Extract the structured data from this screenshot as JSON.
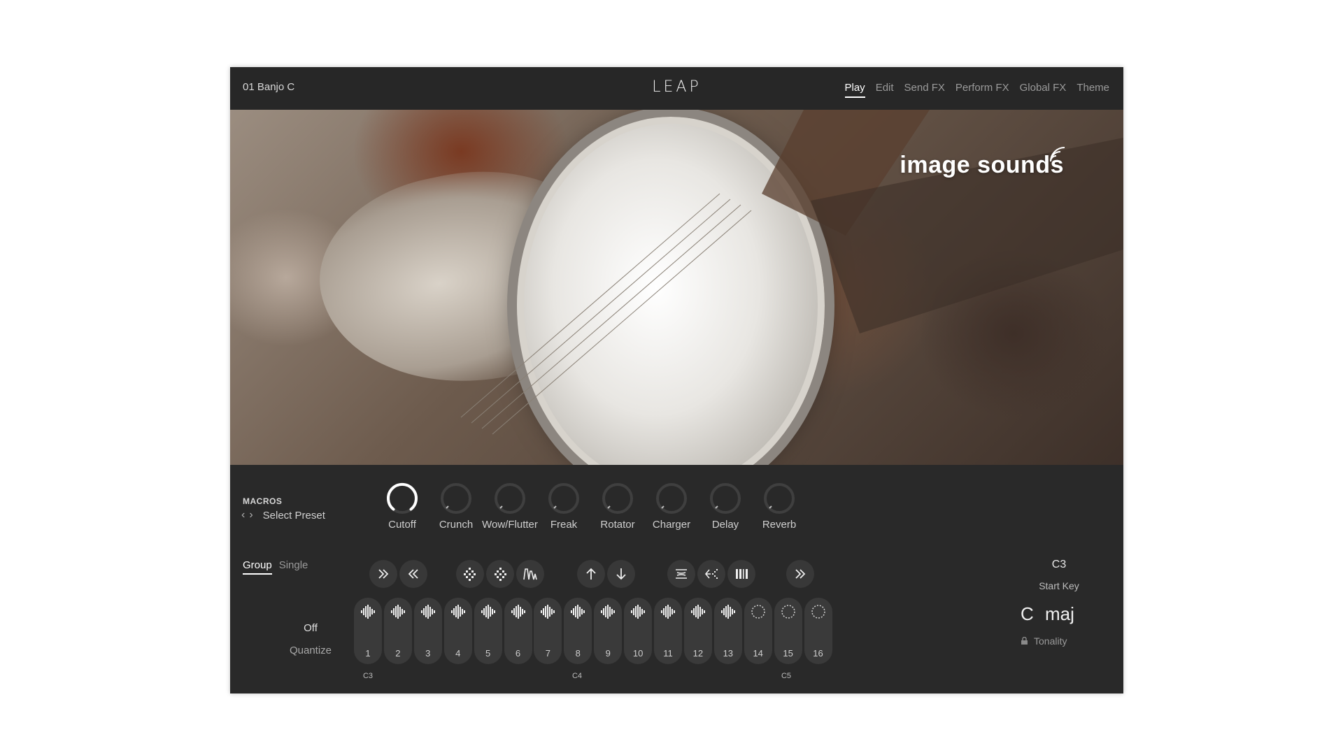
{
  "header": {
    "preset_name": "01 Banjo C",
    "logo": "LEAP",
    "nav": [
      {
        "label": "Play",
        "active": true
      },
      {
        "label": "Edit",
        "active": false
      },
      {
        "label": "Send FX",
        "active": false
      },
      {
        "label": "Perform FX",
        "active": false
      },
      {
        "label": "Global FX",
        "active": false
      },
      {
        "label": "Theme",
        "active": false
      }
    ]
  },
  "hero": {
    "brand": "image sounds"
  },
  "macros": {
    "title": "MACROS",
    "select_preset": "Select Preset",
    "knobs": [
      {
        "label": "Cutoff",
        "value": 0.92
      },
      {
        "label": "Crunch",
        "value": 0.0
      },
      {
        "label": "Wow/Flutter",
        "value": 0.0
      },
      {
        "label": "Freak",
        "value": 0.0
      },
      {
        "label": "Rotator",
        "value": 0.0
      },
      {
        "label": "Charger",
        "value": 0.0
      },
      {
        "label": "Delay",
        "value": 0.0
      },
      {
        "label": "Reverb",
        "value": 0.0
      }
    ]
  },
  "mode": {
    "group": "Group",
    "single": "Single",
    "active": "Group"
  },
  "quantize": {
    "value": "Off",
    "label": "Quantize"
  },
  "toolbar_icons": [
    "double-chevron-right-icon",
    "double-chevron-left-icon",
    "shuffle-pattern-icon",
    "random-pattern-icon",
    "envelope-shape-icon",
    "arrow-up-icon",
    "arrow-down-icon",
    "swap-icon",
    "reverse-icon",
    "slices-icon",
    "double-chevron-right-icon"
  ],
  "pads": {
    "labels": [
      "1",
      "2",
      "3",
      "4",
      "5",
      "6",
      "7",
      "8",
      "9",
      "10",
      "11",
      "12",
      "13",
      "14",
      "15",
      "16"
    ],
    "loaded": [
      true,
      true,
      true,
      true,
      true,
      true,
      true,
      true,
      true,
      true,
      true,
      true,
      true,
      false,
      false,
      false
    ],
    "octave_labels": [
      "C3",
      "C4",
      "C5"
    ]
  },
  "start_key": {
    "value": "C3",
    "label": "Start Key"
  },
  "tonality": {
    "root": "C",
    "scale": "maj",
    "label": "Tonality"
  },
  "colors": {
    "panel": "#292929",
    "accent": "#ffffff",
    "pad": "#3a3a3a"
  }
}
